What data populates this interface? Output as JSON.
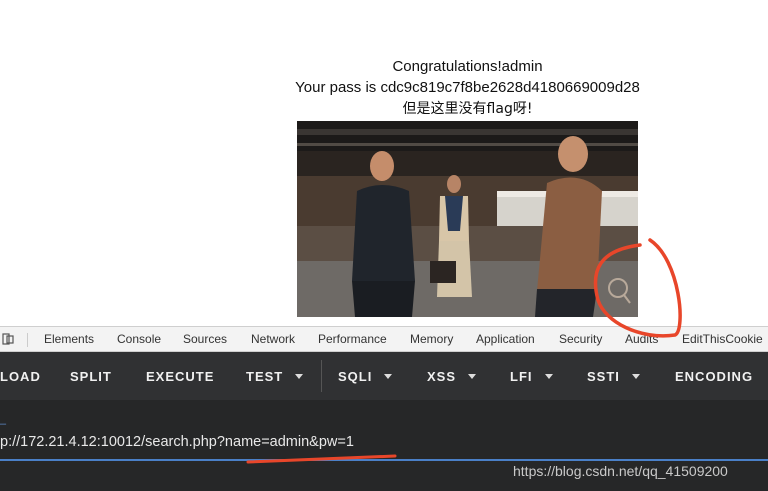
{
  "page": {
    "message_line1": "Congratulations!admin",
    "message_line2": "Your pass is cdc9c819c7f8be2628d4180669009d28",
    "message_line3": "但是这里没有flag呀!"
  },
  "devtools": {
    "tabs": [
      "Elements",
      "Console",
      "Sources",
      "Network",
      "Performance",
      "Memory",
      "Application",
      "Security",
      "Audits",
      "EditThisCookie"
    ]
  },
  "hackbar": {
    "buttons": [
      "LOAD",
      "SPLIT",
      "EXECUTE",
      "TEST",
      "SQLI",
      "XSS",
      "LFI",
      "SSTI",
      "ENCODING"
    ],
    "url": "p://172.21.4.12:10012/search.php?name=admin&pw=1"
  },
  "watermark": "https://blog.csdn.net/qq_41509200",
  "colors": {
    "hackbar_bg": "#303133",
    "url_bg": "#262728",
    "annotation_red": "#e8462a",
    "focus_blue": "#4a80c8"
  }
}
